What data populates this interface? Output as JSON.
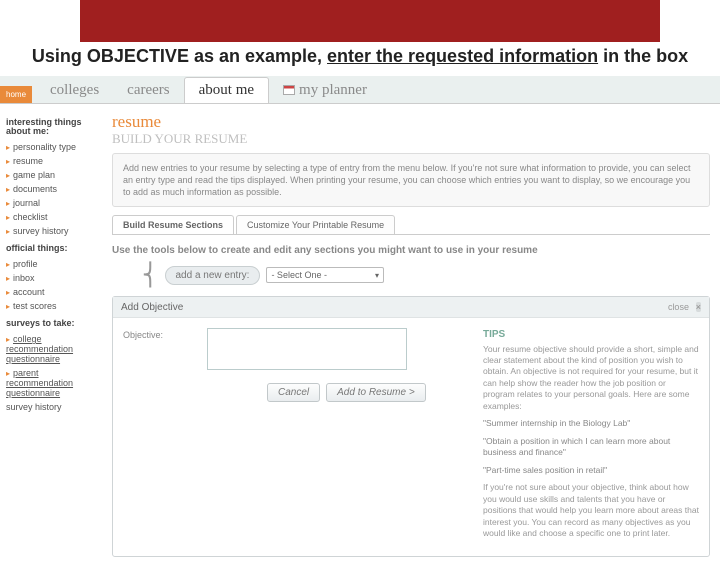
{
  "title": {
    "pre": "Using OBJECTIVE as an example, ",
    "underlined": "enter the requested information",
    "post": " in the box"
  },
  "tabs": {
    "home": "home",
    "colleges": "colleges",
    "careers": "careers",
    "about_me": "about me",
    "my_planner": "my planner"
  },
  "sidebar": {
    "head1": "interesting things about me:",
    "items1": [
      "personality type",
      "resume",
      "game plan",
      "documents",
      "journal",
      "checklist",
      "survey history"
    ],
    "head2": "official things:",
    "items2": [
      "profile",
      "inbox",
      "account",
      "test scores"
    ],
    "head3": "surveys to take:",
    "links": [
      "college recommendation questionnaire",
      "parent recommendation questionnaire"
    ],
    "plain": "survey history"
  },
  "page": {
    "title": "resume",
    "subtitle": "BUILD YOUR RESUME",
    "intro": "Add new entries to your resume by selecting a type of entry from the menu below. If you're not sure what information to provide, you can select an entry type and read the tips displayed. When printing your resume, you can choose which entries you want to display, so we encourage you to add as much information as possible."
  },
  "subtabs": {
    "build": "Build Resume Sections",
    "customize": "Customize Your Printable Resume"
  },
  "tools_text": "Use the tools below to create and edit any sections you might want to use in your resume",
  "add_entry": {
    "label": "add a new entry:",
    "selected": "- Select One -"
  },
  "panel": {
    "title": "Add Objective",
    "close": "close",
    "field_label": "Objective:",
    "cancel": "Cancel",
    "submit": "Add to Resume >"
  },
  "tips": {
    "title": "TIPS",
    "p1": "Your resume objective should provide a short, simple and clear statement about the kind of position you wish to obtain. An objective is not required for your resume, but it can help show the reader how the job position or program relates to your personal goals. Here are some examples:",
    "q1": "\"Summer internship in the Biology Lab\"",
    "q2": "\"Obtain a position in which I can learn more about business and finance\"",
    "q3": "\"Part-time sales position in retail\"",
    "p2": "If you're not sure about your objective, think about how you would use skills and talents that you have or positions that would help you learn more about areas that interest you. You can record as many objectives as you would like and choose a specific one to print later."
  }
}
